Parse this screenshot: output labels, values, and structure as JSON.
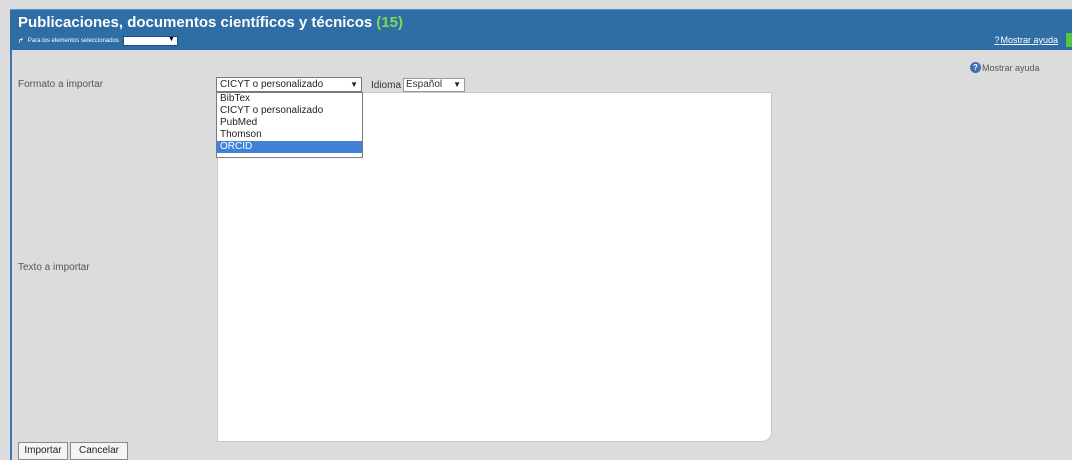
{
  "header": {
    "title": "Publicaciones, documentos científicos y técnicos",
    "count": "(15)",
    "sub_label": "Para los elementos seleccionados",
    "help_link": "Mostrar ayuda"
  },
  "help": {
    "label": "Mostrar ayuda",
    "icon": "question-icon"
  },
  "form": {
    "format_label": "Formato a importar",
    "format_selected": "CICYT o personalizado",
    "format_options": [
      "BibTex",
      "CICYT o personalizado",
      "PubMed",
      "Thomson",
      "ORCID"
    ],
    "highlighted_option": "ORCID",
    "idioma_label": "Idioma",
    "idioma_selected": "Español",
    "text_label": "Texto a importar",
    "text_value": ""
  },
  "buttons": {
    "import_label": "Importar",
    "cancel_label": "Cancelar"
  },
  "colors": {
    "header_bg": "#2e6ea5",
    "count_color": "#7ed957",
    "highlight": "#3f82d8",
    "page_bg": "#dcdcdc"
  }
}
